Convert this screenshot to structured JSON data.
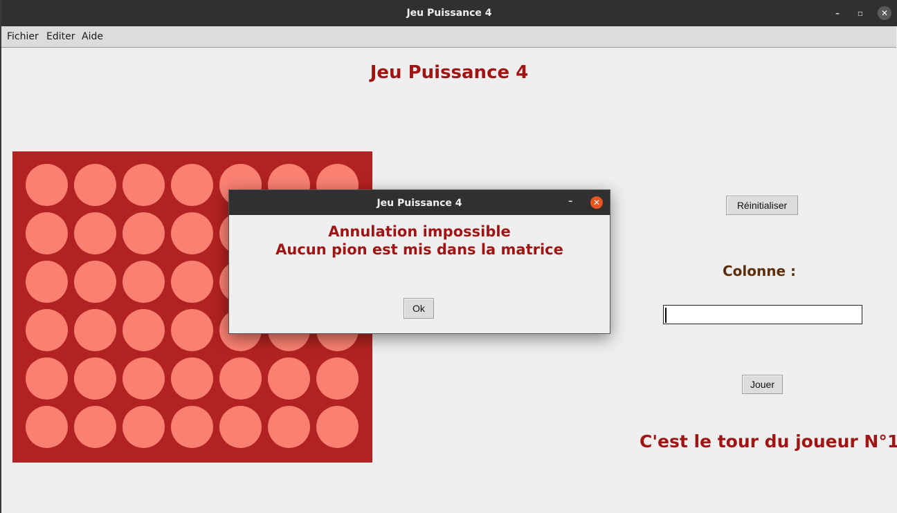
{
  "window": {
    "title": "Jeu Puissance 4",
    "minimize_glyph": "–",
    "maximize_glyph": "▫",
    "close_glyph": "✕"
  },
  "menu": {
    "items": [
      "Fichier",
      "Editer",
      "Aide"
    ]
  },
  "main": {
    "heading": "Jeu Puissance 4",
    "reset_label": "Réinitialiser",
    "column_label": "Colonne :",
    "column_value": "",
    "play_label": "Jouer",
    "status": "C'est le tour du joueur N°1"
  },
  "board": {
    "rows": 6,
    "cols": 7,
    "board_color": "#b22222",
    "empty_color": "#fa8072"
  },
  "dialog": {
    "title": "Jeu Puissance 4",
    "line1": "Annulation impossible",
    "line2": "Aucun pion est mis dans la matrice",
    "ok_label": "Ok",
    "minimize_glyph": "–",
    "close_glyph": "✕"
  },
  "colors": {
    "accent": "#a01414",
    "label_brown": "#5c2e0a",
    "close_orange": "#e95420"
  }
}
